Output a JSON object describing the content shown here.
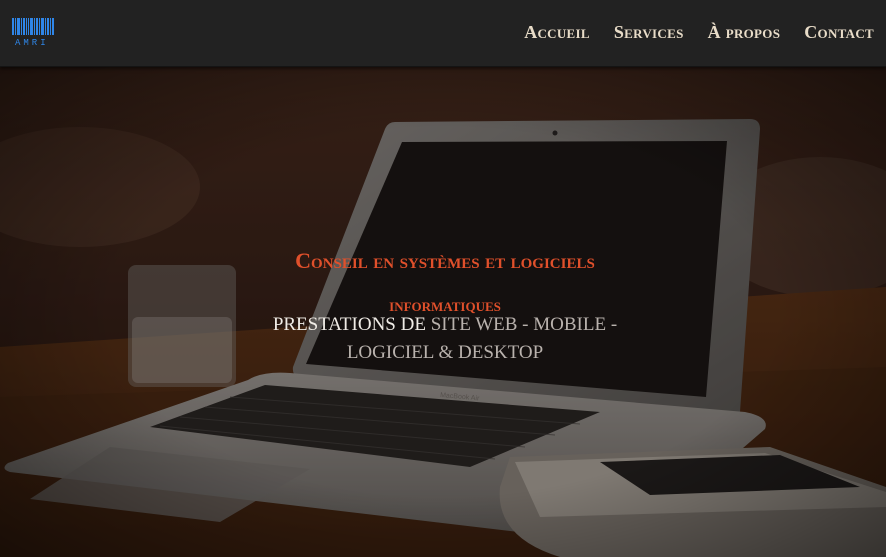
{
  "brand": {
    "logo_text": "AMRI",
    "accent": "#2f86e8"
  },
  "nav": {
    "items": [
      {
        "label": "Accueil"
      },
      {
        "label": "Services"
      },
      {
        "label": "À propos"
      },
      {
        "label": "Contact"
      }
    ]
  },
  "hero": {
    "headline_line1": "Conseil en systèmes et logiciels",
    "headline_line2": "informatiques",
    "subline_part1": "PRESTATIONS DE",
    "subline_part2": "SITE WEB - MOBILE -",
    "subline_line2": "LOGICIEL & DESKTOP",
    "laptop_label": "MacBook Air",
    "headline_color": "#e0502b"
  }
}
